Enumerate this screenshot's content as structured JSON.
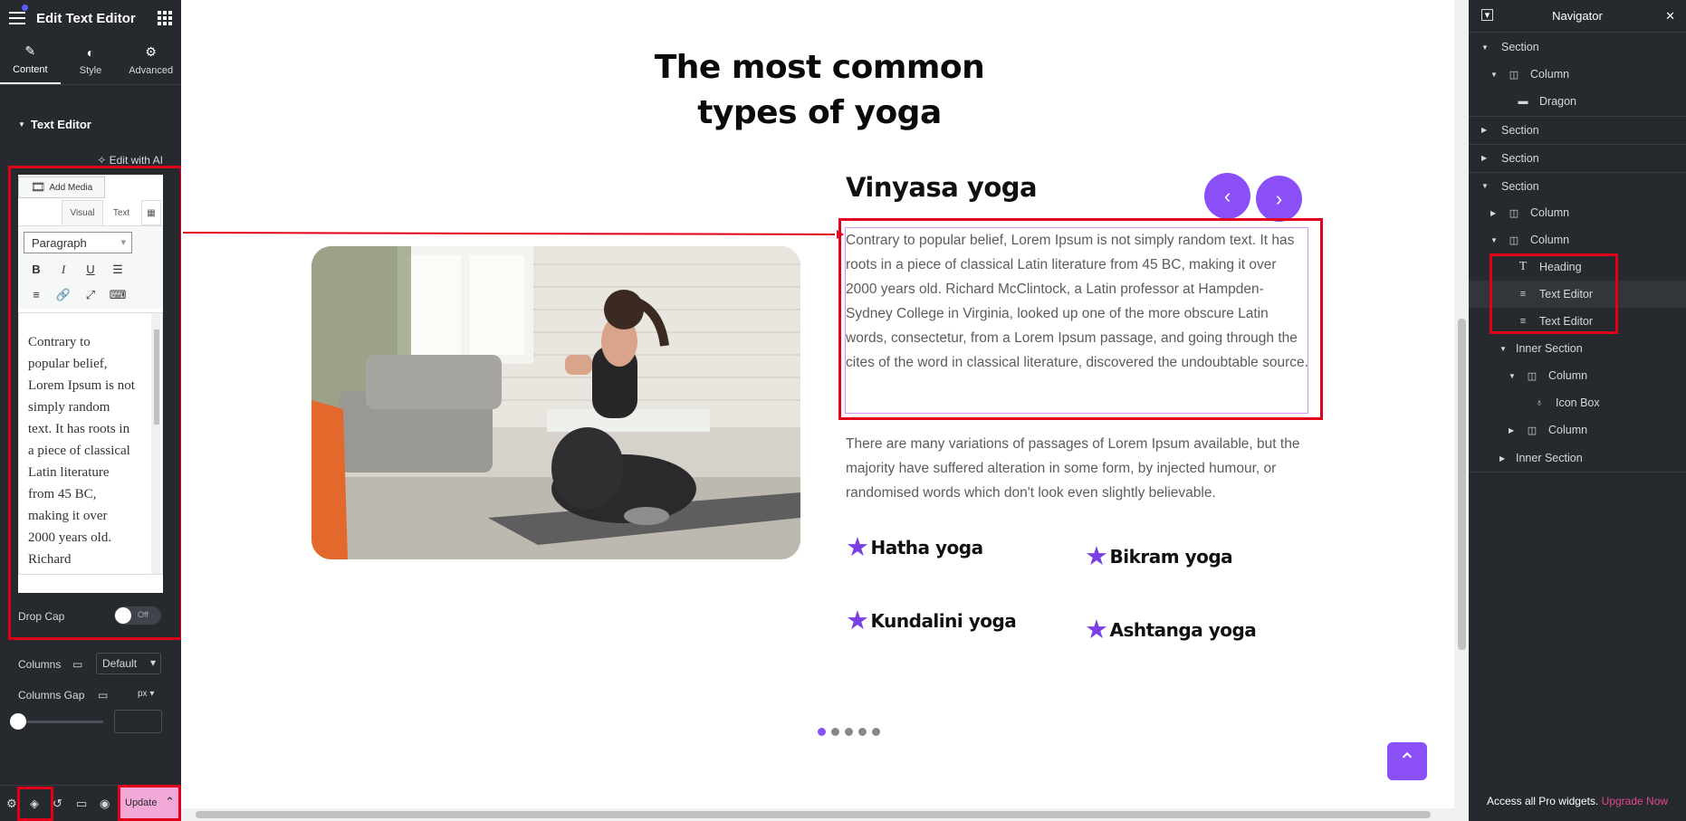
{
  "left_panel": {
    "title": "Edit Text Editor",
    "tabs": [
      {
        "label": "Content",
        "icon": "pencil-icon"
      },
      {
        "label": "Style",
        "icon": "half-circle-icon"
      },
      {
        "label": "Advanced",
        "icon": "gear-icon"
      }
    ],
    "section_title": "Text Editor",
    "edit_ai": "Edit with AI",
    "editor": {
      "add_media": "Add Media",
      "tab_visual": "Visual",
      "tab_text": "Text",
      "format_select": "Paragraph",
      "toolbar": {
        "bold": "B",
        "italic": "I",
        "underline": "U"
      },
      "content": "Contrary to popular belief, Lorem Ipsum is not simply random text. It has roots in a piece of classical Latin literature from 45 BC, making it over 2000 years old. Richard"
    },
    "drop_cap": {
      "label": "Drop Cap",
      "value": "Off"
    },
    "columns": {
      "label": "Columns",
      "value": "Default"
    },
    "columns_gap": {
      "label": "Columns Gap",
      "unit": "px",
      "value": ""
    },
    "footer": {
      "update_label": "Update"
    }
  },
  "canvas": {
    "heading": "The most common types of yoga",
    "card_title": "Vinyasa yoga",
    "paragraph1": "Contrary to popular belief, Lorem Ipsum is not simply random text. It has roots in a piece of classical Latin literature from 45 BC, making it over 2000 years old. Richard McClintock, a Latin professor at Hampden-Sydney College in Virginia, looked up one of the more obscure Latin words, consectetur, from a Lorem Ipsum passage, and going through the cites of the word in classical literature, discovered the undoubtable source.",
    "paragraph2": "There are many variations of passages of Lorem Ipsum available, but the majority have suffered alteration in some form, by injected humour, or randomised words which don't look even slightly believable.",
    "features": [
      "Hatha yoga",
      "Bikram yoga",
      "Kundalini yoga",
      "Ashtanga yoga"
    ],
    "carousel": {
      "prev": "‹",
      "next": "›",
      "slides": 5,
      "active_slide": 1
    },
    "accent_color": "#8b4ff7"
  },
  "navigator": {
    "title": "Navigator",
    "items": [
      {
        "label": "Section",
        "type": "section"
      },
      {
        "label": "Column",
        "type": "column"
      },
      {
        "label": "Dragon",
        "type": "widget"
      },
      {
        "label": "Section",
        "type": "section"
      },
      {
        "label": "Section",
        "type": "section"
      },
      {
        "label": "Section",
        "type": "section"
      },
      {
        "label": "Column",
        "type": "column"
      },
      {
        "label": "Column",
        "type": "column"
      },
      {
        "label": "Heading",
        "type": "heading"
      },
      {
        "label": "Text Editor",
        "type": "text-editor"
      },
      {
        "label": "Text Editor",
        "type": "text-editor"
      },
      {
        "label": "Inner Section",
        "type": "inner-section"
      },
      {
        "label": "Column",
        "type": "column"
      },
      {
        "label": "Icon Box",
        "type": "icon-box"
      },
      {
        "label": "Column",
        "type": "column"
      },
      {
        "label": "Inner Section",
        "type": "inner-section"
      }
    ],
    "footer_text": "Access all Pro widgets.",
    "footer_link": "Upgrade Now"
  }
}
